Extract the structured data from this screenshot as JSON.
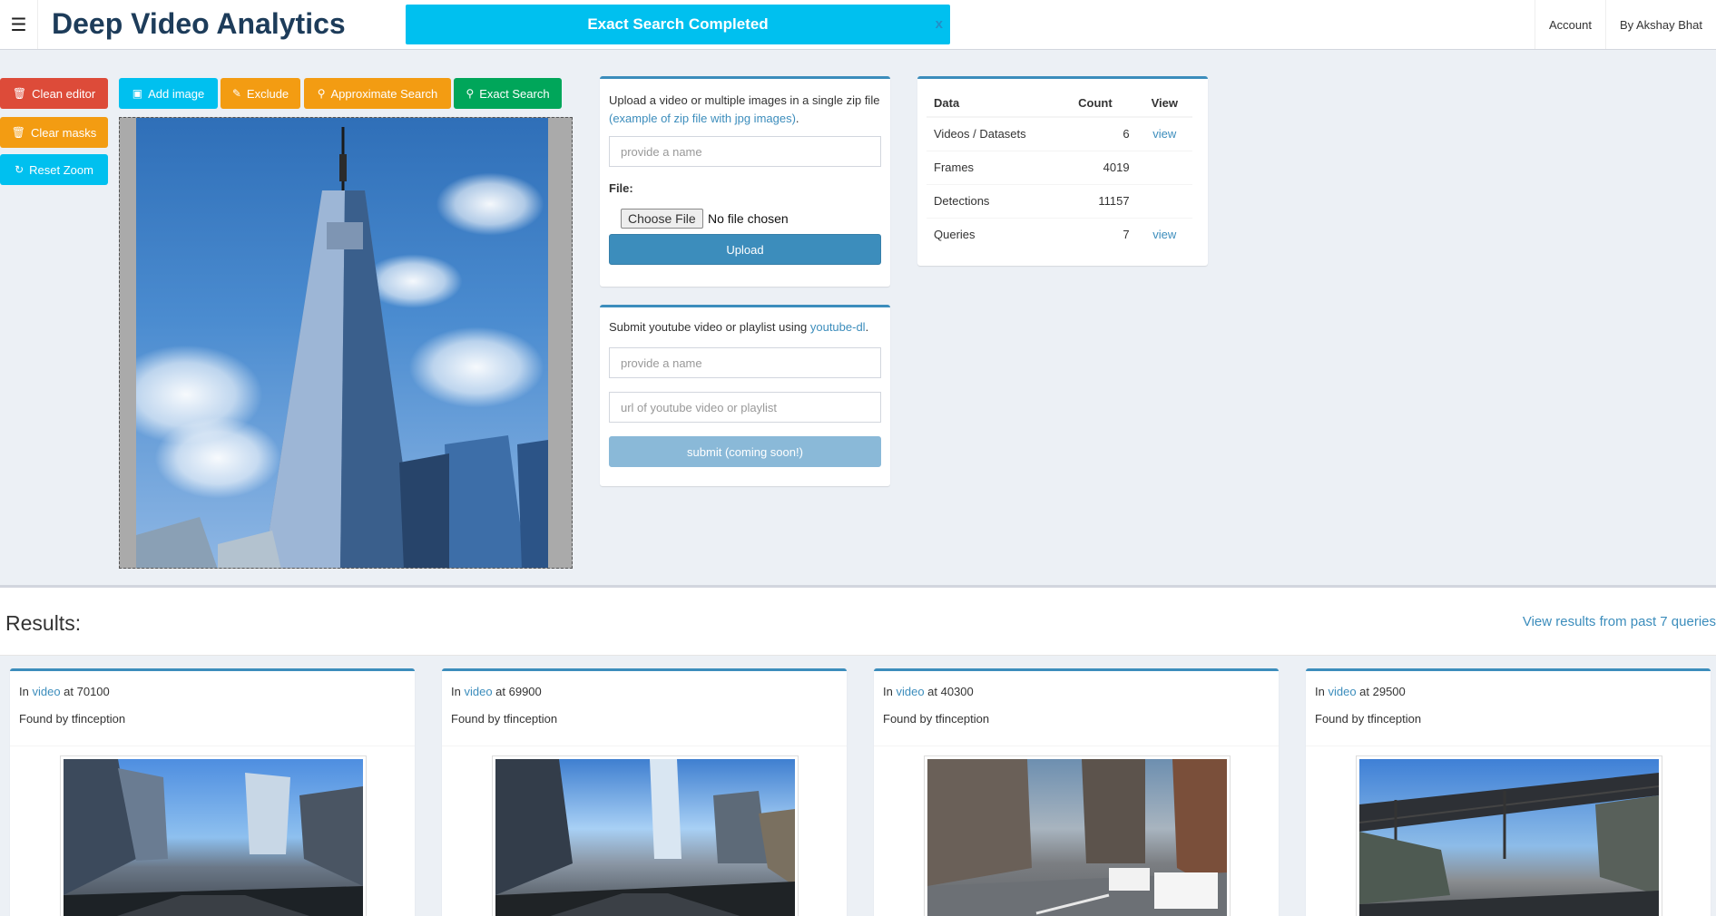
{
  "header": {
    "menu_icon": "hamburger-icon",
    "brand": "Deep Video Analytics",
    "alert_text": "Exact Search Completed",
    "alert_close": "x",
    "nav": [
      "Account",
      "By Akshay Bhat"
    ]
  },
  "toolbar": {
    "clean_editor": "Clean editor",
    "add_image": "Add image",
    "exclude": "Exclude",
    "approx_search": "Approximate Search",
    "exact_search": "Exact Search",
    "clear_masks": "Clear masks",
    "reset_zoom": "Reset Zoom"
  },
  "upload": {
    "intro_before": "Upload a video or multiple images in a single zip file ",
    "intro_link": "(example of zip file with jpg images)",
    "intro_after": ".",
    "name_placeholder": "provide a name",
    "file_label": "File:",
    "choose_file": "Choose File",
    "file_status": "No file chosen",
    "upload_button": "Upload"
  },
  "youtube": {
    "intro_before": "Submit youtube video or playlist using ",
    "intro_link": "youtube-dl",
    "intro_after": ".",
    "name_placeholder": "provide a name",
    "url_placeholder": "url of youtube video or playlist",
    "submit_button": "submit (coming soon!)"
  },
  "stats": {
    "headers": [
      "Data",
      "Count",
      "View"
    ],
    "rows": [
      {
        "name": "Videos / Datasets",
        "count": "6",
        "view": "view"
      },
      {
        "name": "Frames",
        "count": "4019",
        "view": ""
      },
      {
        "name": "Detections",
        "count": "11157",
        "view": ""
      },
      {
        "name": "Queries",
        "count": "7",
        "view": "view"
      }
    ]
  },
  "results": {
    "title": "Results:",
    "past_link": "View results from past 7 queries",
    "cards": [
      {
        "prefix": "In ",
        "link": "video",
        "suffix": " at 70100",
        "found": "Found by tfinception"
      },
      {
        "prefix": "In ",
        "link": "video",
        "suffix": " at 69900",
        "found": "Found by tfinception"
      },
      {
        "prefix": "In ",
        "link": "video",
        "suffix": " at 40300",
        "found": "Found by tfinception"
      },
      {
        "prefix": "In ",
        "link": "video",
        "suffix": " at 29500",
        "found": "Found by tfinception"
      }
    ]
  }
}
